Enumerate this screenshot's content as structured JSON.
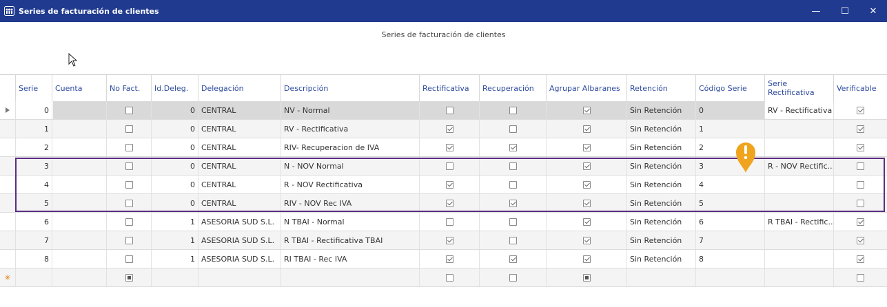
{
  "window": {
    "title": "Series de facturación de clientes",
    "minimize": "—",
    "maximize": "☐",
    "close": "✕"
  },
  "subtitle": "Series de facturación de clientes",
  "columns": [
    {
      "key": "serie",
      "label": "Serie"
    },
    {
      "key": "cuenta",
      "label": "Cuenta"
    },
    {
      "key": "nofact",
      "label": "No Fact."
    },
    {
      "key": "iddeleg",
      "label": "Id.Deleg."
    },
    {
      "key": "delegacion",
      "label": "Delegación"
    },
    {
      "key": "descripcion",
      "label": "Descripción"
    },
    {
      "key": "rectificativa",
      "label": "Rectificativa"
    },
    {
      "key": "recuperacion",
      "label": "Recuperación"
    },
    {
      "key": "agrupar",
      "label": "Agrupar Albaranes"
    },
    {
      "key": "retencion",
      "label": "Retención"
    },
    {
      "key": "codigo",
      "label": "Código Serie"
    },
    {
      "key": "serierect",
      "label": "Serie\nRectificativa"
    },
    {
      "key": "verificable",
      "label": "Verificable"
    }
  ],
  "rows": [
    {
      "serie": "0",
      "nofact": false,
      "iddeleg": "0",
      "delegacion": "CENTRAL",
      "descripcion": "NV - Normal",
      "rectificativa": false,
      "recuperacion": false,
      "agrupar": true,
      "retencion": "Sin Retención",
      "codigo": "0",
      "serierect": "RV - Rectificativa",
      "verificable": true
    },
    {
      "serie": "1",
      "nofact": false,
      "iddeleg": "0",
      "delegacion": "CENTRAL",
      "descripcion": "RV - Rectificativa",
      "rectificativa": true,
      "recuperacion": false,
      "agrupar": true,
      "retencion": "Sin Retención",
      "codigo": "1",
      "serierect": "",
      "verificable": true
    },
    {
      "serie": "2",
      "nofact": false,
      "iddeleg": "0",
      "delegacion": "CENTRAL",
      "descripcion": "RIV- Recuperacion de IVA",
      "rectificativa": true,
      "recuperacion": true,
      "agrupar": true,
      "retencion": "Sin Retención",
      "codigo": "2",
      "serierect": "",
      "verificable": true
    },
    {
      "serie": "3",
      "nofact": false,
      "iddeleg": "0",
      "delegacion": "CENTRAL",
      "descripcion": "N - NOV Normal",
      "rectificativa": false,
      "recuperacion": false,
      "agrupar": true,
      "retencion": "Sin Retención",
      "codigo": "3",
      "serierect": "R - NOV Rectific...",
      "verificable": false
    },
    {
      "serie": "4",
      "nofact": false,
      "iddeleg": "0",
      "delegacion": "CENTRAL",
      "descripcion": "R - NOV Rectificativa",
      "rectificativa": true,
      "recuperacion": false,
      "agrupar": true,
      "retencion": "Sin Retención",
      "codigo": "4",
      "serierect": "",
      "verificable": false
    },
    {
      "serie": "5",
      "nofact": false,
      "iddeleg": "0",
      "delegacion": "CENTRAL",
      "descripcion": "RIV - NOV Rec IVA",
      "rectificativa": true,
      "recuperacion": true,
      "agrupar": true,
      "retencion": "Sin Retención",
      "codigo": "5",
      "serierect": "",
      "verificable": false
    },
    {
      "serie": "6",
      "nofact": false,
      "iddeleg": "1",
      "delegacion": "ASESORIA SUD S.L.",
      "descripcion": "N TBAI - Normal",
      "rectificativa": false,
      "recuperacion": false,
      "agrupar": true,
      "retencion": "Sin Retención",
      "codigo": "6",
      "serierect": "R TBAI - Rectific...",
      "verificable": true
    },
    {
      "serie": "7",
      "nofact": false,
      "iddeleg": "1",
      "delegacion": "ASESORIA SUD S.L.",
      "descripcion": "R TBAI - Rectificativa TBAI",
      "rectificativa": true,
      "recuperacion": false,
      "agrupar": true,
      "retencion": "Sin Retención",
      "codigo": "7",
      "serierect": "",
      "verificable": true
    },
    {
      "serie": "8",
      "nofact": false,
      "iddeleg": "1",
      "delegacion": "ASESORIA SUD S.L.",
      "descripcion": "RI TBAI - Rec IVA",
      "rectificativa": true,
      "recuperacion": true,
      "agrupar": true,
      "retencion": "Sin Retención",
      "codigo": "8",
      "serierect": "",
      "verificable": true
    }
  ],
  "new_row": {
    "marker": "✳",
    "nofact": "ind",
    "rectificativa": "off",
    "recuperacion": "off",
    "agrupar": "ind",
    "verificable": "off"
  },
  "colors": {
    "titlebar": "#1f3a8f",
    "header_text": "#2c4a9e",
    "highlight": "#5a2d82",
    "warning_pin": "#f0a31c"
  },
  "icons": {
    "warning": "warning-pin-icon",
    "row_pointer": "row-pointer-icon",
    "new_row": "new-row-icon"
  }
}
